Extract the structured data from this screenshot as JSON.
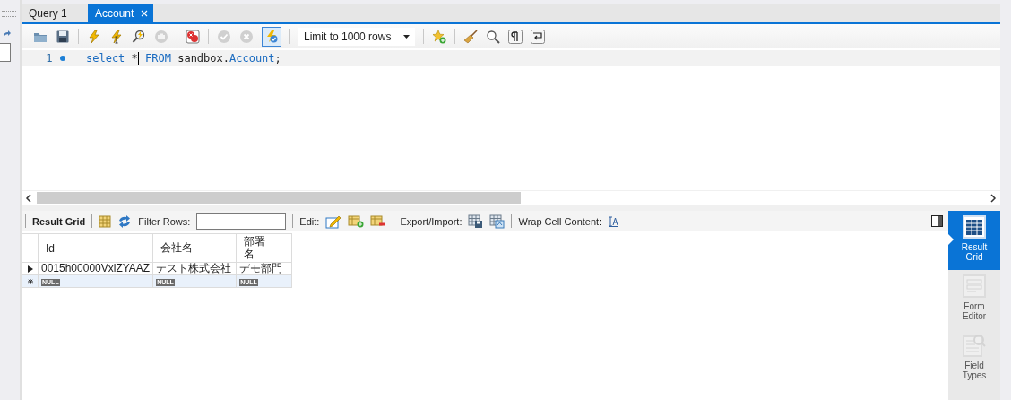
{
  "tabs": [
    {
      "label": "Query 1",
      "selected": false
    },
    {
      "label": "Account",
      "selected": true
    }
  ],
  "toolbar": [
    {
      "kind": "open"
    },
    {
      "kind": "save"
    },
    {
      "kind": "separator"
    },
    {
      "kind": "run"
    },
    {
      "kind": "runline"
    },
    {
      "kind": "explain"
    },
    {
      "kind": "stop",
      "disabled": true
    },
    {
      "kind": "separator"
    },
    {
      "kind": "errors"
    },
    {
      "kind": "separator"
    },
    {
      "kind": "commit",
      "disabled": true
    },
    {
      "kind": "rollback",
      "disabled": true
    },
    {
      "kind": "autocommit",
      "on": true
    },
    {
      "kind": "separator"
    },
    {
      "kind": "limit",
      "label": "Limit to 1000 rows"
    },
    {
      "kind": "separator"
    },
    {
      "kind": "snippet"
    },
    {
      "kind": "separator"
    },
    {
      "kind": "beautify"
    },
    {
      "kind": "find"
    },
    {
      "kind": "invisibles"
    },
    {
      "kind": "wrap"
    }
  ],
  "editor": {
    "lines": [
      {
        "number": "1",
        "tokens": [
          {
            "text": "select",
            "kind": "keyword"
          },
          {
            "text": " * ",
            "kind": "plain"
          },
          {
            "text": "FROM",
            "kind": "keyword"
          },
          {
            "text": " sandbox.",
            "kind": "plain"
          },
          {
            "text": "Account",
            "kind": "keyword"
          },
          {
            "text": ";",
            "kind": "plain"
          }
        ]
      }
    ]
  },
  "result_toolbar": {
    "title": "Result Grid",
    "filter_label": "Filter Rows:",
    "edit_label": "Edit:",
    "export_label": "Export/Import:",
    "wrap_label": "Wrap Cell Content:"
  },
  "table": {
    "columns": [
      "Id",
      "会社名",
      "部署名"
    ],
    "rows": [
      {
        "kind": "current",
        "cells": [
          {
            "text": "0015h00000VxiZYAAZ",
            "kind": "value"
          },
          {
            "text": "テスト株式会社",
            "kind": "value"
          },
          {
            "text": "デモ部門",
            "kind": "value"
          }
        ]
      },
      {
        "kind": "new",
        "cells": [
          {
            "text": "NULL",
            "kind": "null"
          },
          {
            "text": "NULL",
            "kind": "null"
          },
          {
            "text": "NULL",
            "kind": "null"
          }
        ]
      }
    ]
  },
  "side_panel": [
    {
      "label": "Result Grid",
      "kind": "grid",
      "selected": true
    },
    {
      "label": "Form Editor",
      "kind": "form",
      "selected": false
    },
    {
      "label": "Field Types",
      "kind": "fields",
      "selected": false
    }
  ]
}
